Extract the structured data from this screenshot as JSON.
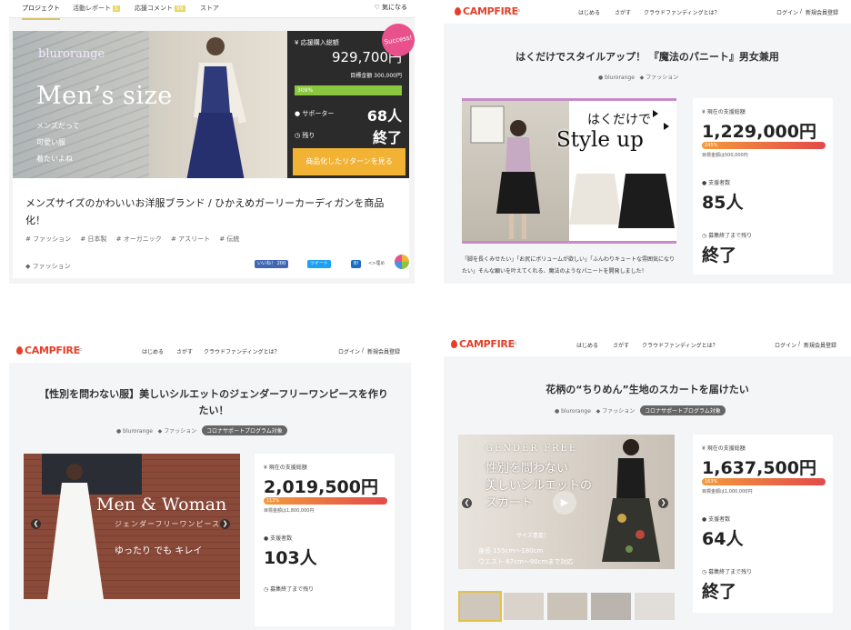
{
  "panel1": {
    "tabs": [
      {
        "label": "プロジェクト",
        "count": ""
      },
      {
        "label": "活動レポート",
        "count": "5"
      },
      {
        "label": "応援コメント",
        "count": "99"
      },
      {
        "label": "ストア",
        "count": ""
      }
    ],
    "favorite_label": "気になる",
    "hero": {
      "brand": "blurorange",
      "title": "Men’s size",
      "sub_lines": [
        "メンズだって",
        "可愛い服",
        "着たいよね"
      ]
    },
    "status_box": {
      "total_label": "応援購入総額",
      "total_value": "929,700円",
      "goal_text": "目標金額 300,000円",
      "percent_text": "309%",
      "progress": 1.0,
      "supporters_label": "サポーター",
      "supporters_value": "68人",
      "remaining_label": "残り",
      "remaining_value": "終了",
      "cta_label": "商品化したリターンを見る",
      "success_badge": "Success!"
    },
    "description": {
      "title": "メンズサイズのかわいいお洋服ブランド / ひかえめガーリーカーディガンを商品化！",
      "tags": [
        "# ファッション",
        "# 日本製",
        "# オーガニック",
        "# アスリート",
        "# 伝統"
      ],
      "category": "ファッション",
      "share_like": "いいね！ 200",
      "share_tweet": "ツイート",
      "share_b": "B!",
      "share_embed": "<>埋め"
    }
  },
  "campfire_header": {
    "logo": "CAMPFIRE",
    "nav": [
      "はじめる",
      "さがす",
      "クラウドファンディングとは？"
    ],
    "login": "ログイン",
    "separator": "/",
    "register": "新規会員登録"
  },
  "panel2": {
    "title": "はくだけでスタイルアップ！ 『魔法のパニート』男女兼用",
    "owner": "blurorange",
    "category": "ファッション",
    "image_text_1": "はくだけで",
    "image_text_2": "Style up",
    "body": "「脚を長くみせたい」「お尻にボリュームが欲しい」「ふんわりキュートな雰囲気になりたい」そんな願いを叶えてくれる、魔法のようなパニートを開発しました！",
    "stats": {
      "total_label": "現在の支援総額",
      "total_value": "1,229,000円",
      "percent_text": "245%",
      "progress": 1.0,
      "goal_text": "目標金額は500,000円",
      "supporters_label": "支援者数",
      "supporters_value": "85人",
      "deadline_label": "募集終了まで残り",
      "deadline_value": "終了"
    }
  },
  "panel3": {
    "title": "【性別を問わない服】美しいシルエットのジェンダーフリーワンピースを作りたい！",
    "owner": "blurorange",
    "category": "ファッション",
    "badge": "コロナサポートプログラム対象",
    "image_text_1": "Men & Woman",
    "image_text_2": "ジェンダーフリーワンピース",
    "image_text_3": "ゆったり でも キレイ",
    "stats": {
      "total_label": "現在の支援総額",
      "total_value": "2,019,500円",
      "percent_text": "112%",
      "progress": 1.0,
      "goal_text": "目標金額は1,800,000円",
      "supporters_label": "支援者数",
      "supporters_value": "103人",
      "deadline_label": "募集終了まで残り"
    }
  },
  "panel4": {
    "title": "花柄の“ちりめん”生地のスカートを届けたい",
    "owner": "blurorange",
    "category": "ファッション",
    "badge": "コロナサポートプログラム対象",
    "image_text_1": "GENDER FREE",
    "image_text_2": [
      "性別を問わない",
      "美しいシルエットの",
      "スカート"
    ],
    "image_text_3": "サイズ豊富！",
    "image_text_4": [
      "身長 155cm〜180cm",
      "ウエスト 67cm〜90cmまで対応"
    ],
    "stats": {
      "total_label": "現在の支援総額",
      "total_value": "1,637,500円",
      "percent_text": "163%",
      "progress": 1.0,
      "goal_text": "目標金額は1,000,000円",
      "supporters_label": "支援者数",
      "supporters_value": "64人",
      "deadline_label": "募集終了まで残り",
      "deadline_value": "終了"
    }
  },
  "colors": {
    "campfire_red": "#e3402a",
    "cta_orange": "#f2b233",
    "progress_green": "#8bc63f",
    "success_pink": "#e8518c"
  }
}
